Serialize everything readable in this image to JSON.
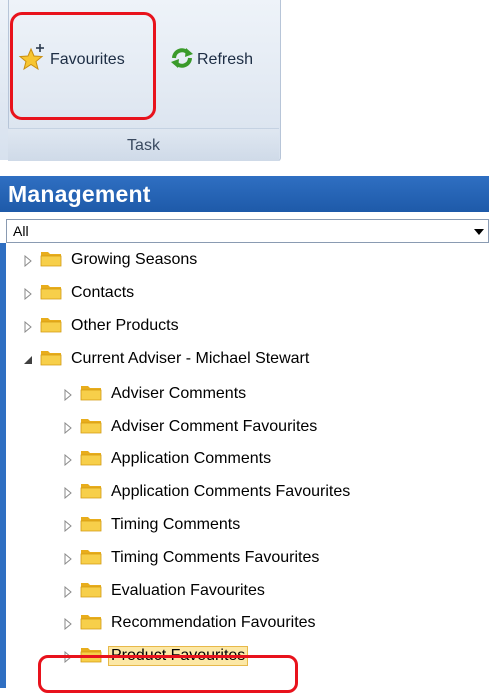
{
  "ribbon": {
    "favourites_label": "Favourites",
    "refresh_label": "Refresh",
    "group_caption": "Task"
  },
  "management": {
    "title": "Management",
    "filter_value": "All"
  },
  "tree": {
    "items": [
      {
        "label": "Growing Seasons",
        "level": 0,
        "expanded": false
      },
      {
        "label": "Contacts",
        "level": 0,
        "expanded": false
      },
      {
        "label": "Other Products",
        "level": 0,
        "expanded": false
      },
      {
        "label": "Current Adviser - Michael Stewart",
        "level": 0,
        "expanded": true
      },
      {
        "label": "Adviser Comments",
        "level": 1,
        "expanded": false
      },
      {
        "label": "Adviser Comment Favourites",
        "level": 1,
        "expanded": false
      },
      {
        "label": "Application Comments",
        "level": 1,
        "expanded": false
      },
      {
        "label": "Application Comments Favourites",
        "level": 1,
        "expanded": false
      },
      {
        "label": "Timing Comments",
        "level": 1,
        "expanded": false
      },
      {
        "label": "Timing Comments Favourites",
        "level": 1,
        "expanded": false
      },
      {
        "label": "Evaluation Favourites",
        "level": 1,
        "expanded": false
      },
      {
        "label": "Recommendation Favourites",
        "level": 1,
        "expanded": false
      },
      {
        "label": "Product Favourites",
        "level": 1,
        "expanded": false,
        "selected": true
      }
    ]
  },
  "colors": {
    "header_blue": "#1e5aa9",
    "highlight_red": "#e8121c",
    "folder_yellow": "#f2c230",
    "selection": "#fce8a6"
  },
  "icons": {
    "favourites": "star-plus-icon",
    "refresh": "refresh-icon",
    "folder": "folder-icon"
  }
}
